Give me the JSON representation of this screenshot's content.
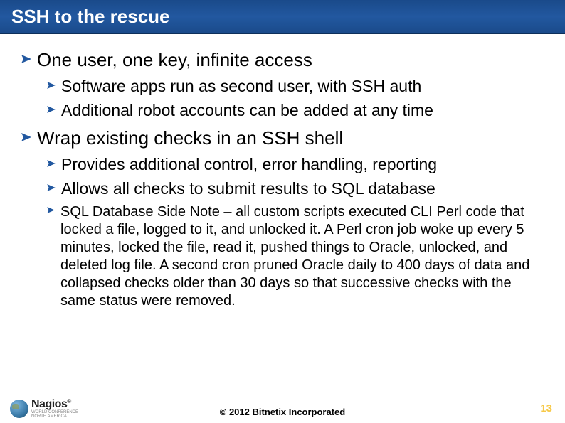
{
  "title": "SSH to the rescue",
  "bullets": {
    "b1": "One user, one key, infinite access",
    "b1a": "Software apps run as second user, with SSH auth",
    "b1b": "Additional robot accounts can be added at any time",
    "b2": "Wrap existing checks in an SSH shell",
    "b2a": "Provides additional control, error handling, reporting",
    "b2b": "Allows all checks to submit results to SQL database",
    "b3": "SQL Database Side Note – all custom scripts executed CLI Perl code that locked a file, logged to it, and unlocked it.  A Perl cron job woke up every 5 minutes, locked the file, read it, pushed things to Oracle, unlocked, and deleted log file.  A second cron pruned Oracle daily to 400 days of data and collapsed checks older than 30 days so that successive checks with the same status were removed."
  },
  "footer": {
    "logo_main": "Nagios",
    "logo_sub": "World Conference",
    "logo_sub2": "North America",
    "copyright": "© 2012 Bitnetix Incorporated",
    "page": "13"
  }
}
